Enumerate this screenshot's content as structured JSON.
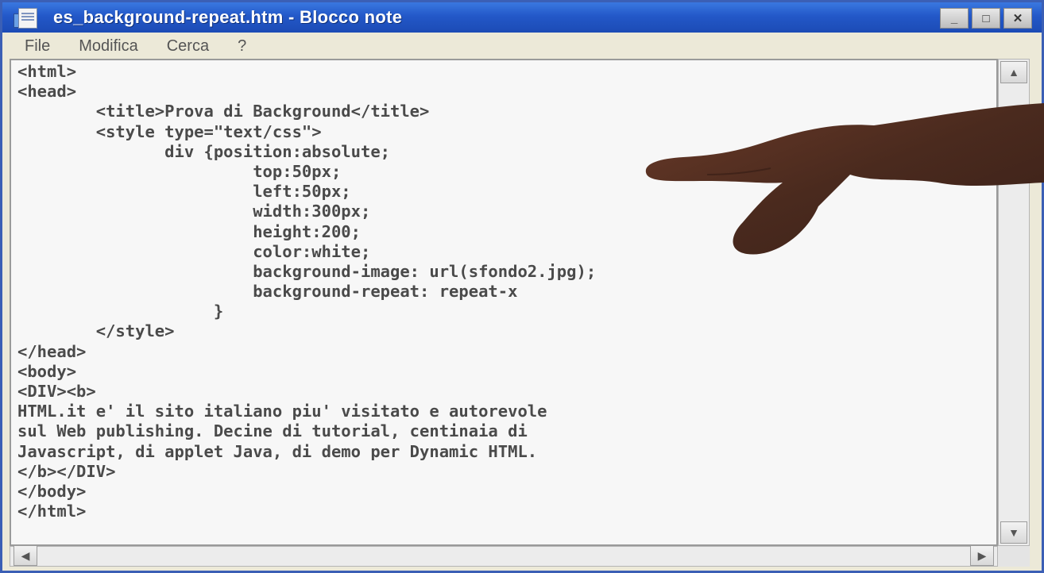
{
  "window": {
    "title": "es_background-repeat.htm - Blocco note",
    "buttons": {
      "minimize": "_",
      "maximize": "□",
      "close": "✕"
    }
  },
  "menu": [
    "File",
    "Modifica",
    "Cerca",
    "?"
  ],
  "editor": {
    "lines": [
      "<html>",
      "<head>",
      "        <title>Prova di Background</title>",
      "        <style type=\"text/css\">",
      "               div {position:absolute;",
      "                        top:50px;",
      "                        left:50px;",
      "                        width:300px;",
      "                        height:200;",
      "                        color:white;",
      "                        background-image: url(sfondo2.jpg);",
      "                        background-repeat: repeat-x",
      "                    }",
      "        </style>",
      "</head>",
      "<body>",
      "<DIV><b>",
      "HTML.it e' il sito italiano piu' visitato e autorevole",
      "sul Web publishing. Decine di tutorial, centinaia di",
      "Javascript, di applet Java, di demo per Dynamic HTML.",
      "</b></DIV>",
      "</body>",
      "</html>"
    ]
  },
  "scrollbars": {
    "up": "▲",
    "down": "▼",
    "left": "◀",
    "right": "▶"
  },
  "colors": {
    "titlebar": "#2358c8",
    "editor_bg": "#f7f7f7",
    "text": "#4a4a4a",
    "hand": "#4a2a1e"
  }
}
